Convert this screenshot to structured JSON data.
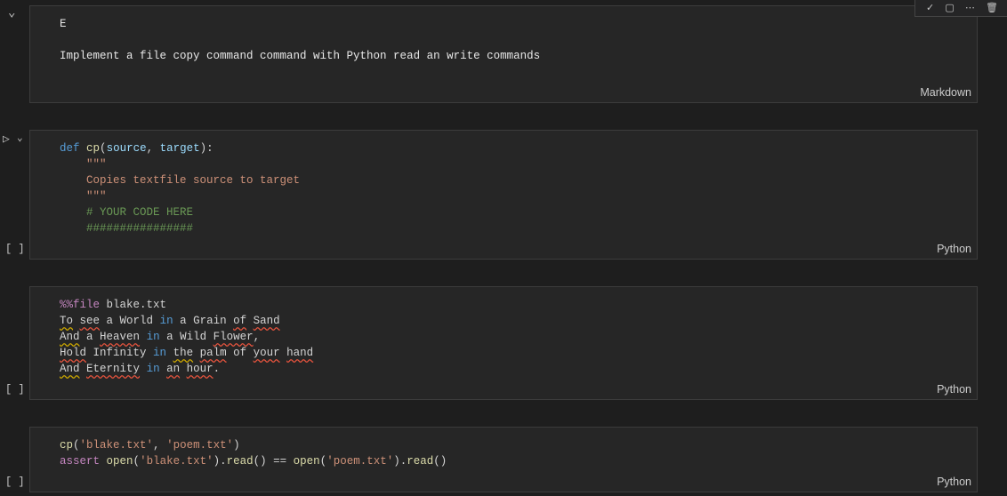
{
  "toolbar": {
    "icons": [
      "check-icon",
      "split-cell-icon",
      "more-icon",
      "trash-icon"
    ],
    "check_glyph": "✓",
    "split_glyph": "▢",
    "more_glyph": "⋯",
    "trash_glyph": "🗑"
  },
  "cells": [
    {
      "type": "markdown",
      "collapse_glyph": "⌄",
      "lines": [
        "E",
        "Implement a file copy command command with Python read an write commands"
      ],
      "language": "Markdown"
    },
    {
      "type": "code",
      "run_glyph": "▷",
      "collapse_glyph": "⌄",
      "exec_label": "[ ]",
      "language": "Python",
      "tokens": {
        "def": "def",
        "name": "cp",
        "source": "source",
        "target": "target",
        "doc_quote": "\"\"\"",
        "docstring": "Copies textfile source to target",
        "comment1": "# YOUR CODE HERE",
        "comment2": "################"
      }
    },
    {
      "type": "code",
      "exec_label": "[ ]",
      "language": "Python",
      "magic": "%%file",
      "filename": "blake.txt",
      "poem": [
        "To see a World in a Grain of Sand",
        "And a Heaven in a Wild Flower,",
        "Hold Infinity in the palm of your hand",
        "And Eternity in an hour."
      ]
    },
    {
      "type": "code",
      "exec_label": "[ ]",
      "language": "Python",
      "line1": {
        "fn": "cp",
        "arg1": "'blake.txt'",
        "arg2": "'poem.txt'"
      },
      "line2": {
        "kw": "assert",
        "open": "open",
        "arg1": "'blake.txt'",
        "read": "read",
        "op": "==",
        "arg2": "'poem.txt'"
      }
    }
  ]
}
